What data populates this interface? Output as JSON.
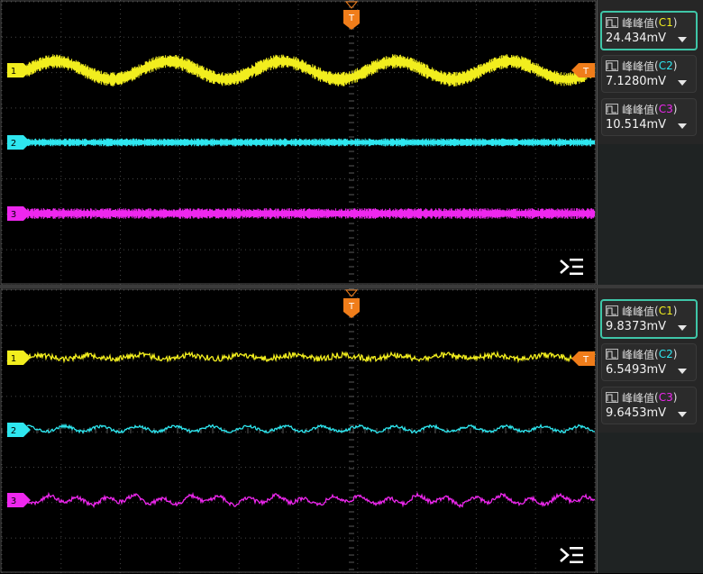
{
  "colors": {
    "ch1": "#f2ee1e",
    "ch2": "#2ee6ef",
    "ch3": "#ee27ee",
    "trigger": "#f07d1a",
    "grid": "#454545",
    "accent": "#3fc6a8"
  },
  "trigger_label": "T",
  "menu_icon": "expand-menu-icon",
  "panels": [
    {
      "name": "top",
      "channel_markers": [
        "1",
        "2",
        "3"
      ],
      "measurements": [
        {
          "label": "峰峰值",
          "channel": "C1",
          "value": "24.434mV",
          "active": true
        },
        {
          "label": "峰峰值",
          "channel": "C2",
          "value": "7.1280mV",
          "active": false
        },
        {
          "label": "峰峰值",
          "channel": "C3",
          "value": "10.514mV",
          "active": false
        }
      ]
    },
    {
      "name": "bottom",
      "channel_markers": [
        "1",
        "2",
        "3"
      ],
      "measurements": [
        {
          "label": "峰峰值",
          "channel": "C1",
          "value": "9.8373mV",
          "active": true
        },
        {
          "label": "峰峰值",
          "channel": "C2",
          "value": "6.5493mV",
          "active": false
        },
        {
          "label": "峰峰值",
          "channel": "C3",
          "value": "9.6453mV",
          "active": false
        }
      ]
    }
  ]
}
